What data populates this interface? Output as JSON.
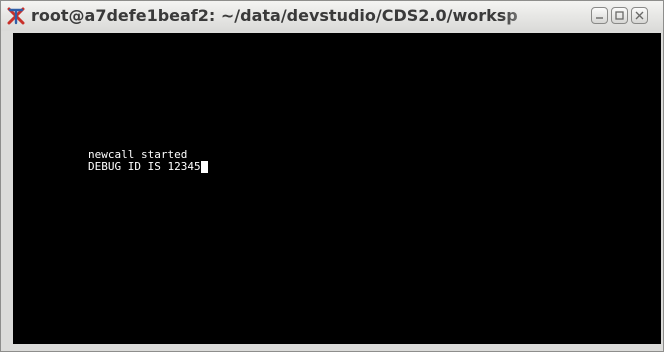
{
  "window": {
    "title": "root@a7defe1beaf2: ~/data/devstudio/CDS2.0/worksp",
    "app_icon": "xterm-icon",
    "buttons": [
      "minimize-icon",
      "maximize-icon",
      "close-icon"
    ]
  },
  "terminal": {
    "background": "#000000",
    "foreground": "#ffffff",
    "lines": [
      "newcall started",
      "DEBUG ID IS 12345"
    ]
  },
  "colors": {
    "titlebar": "#e6e6e4",
    "title_text": "#3a3a3a",
    "icon_red": "#c8302a",
    "icon_blue": "#2f5ea8"
  }
}
